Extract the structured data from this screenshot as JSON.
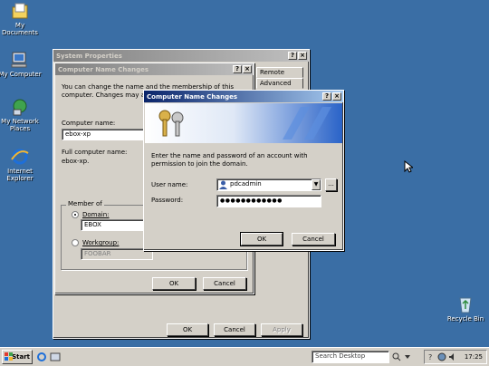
{
  "desktop": {
    "icons": [
      {
        "label": "My Documents",
        "icon": "my-documents-icon"
      },
      {
        "label": "My Computer",
        "icon": "my-computer-icon"
      },
      {
        "label": "My Network Places",
        "icon": "network-places-icon"
      },
      {
        "label": "Internet Explorer",
        "icon": "internet-explorer-icon"
      },
      {
        "label": "Recycle Bin",
        "icon": "recycle-bin-icon"
      }
    ]
  },
  "sysprops": {
    "title": "System Properties",
    "help": "?",
    "close": "×",
    "tabs": [
      "Remote",
      "Advanced"
    ],
    "ok": "OK",
    "cancel": "Cancel",
    "apply": "Apply"
  },
  "cnc": {
    "title": "Computer Name Changes",
    "intro": "You can change the name and the membership of this computer. Changes may affect",
    "computer_name_label": "Computer name:",
    "computer_name_value": "ebox-xp",
    "full_name_label": "Full computer name:",
    "full_name_value": "ebox-xp.",
    "member_of": "Member of",
    "domain_label": "Domain:",
    "domain_value": "EBOX",
    "workgroup_label": "Workgroup:",
    "workgroup_value": "FOOBAR",
    "ok": "OK",
    "cancel": "Cancel"
  },
  "auth": {
    "title": "Computer Name Changes",
    "message": "Enter the name and password of an account with permission to join the domain.",
    "username_label": "User name:",
    "username_value": "pdcadmin",
    "password_label": "Password:",
    "password_value": "●●●●●●●●●●●●",
    "browse": "...",
    "ok": "OK",
    "cancel": "Cancel"
  },
  "taskbar": {
    "start": "Start",
    "search_placeholder": "Search Desktop",
    "clock": "17:25"
  }
}
